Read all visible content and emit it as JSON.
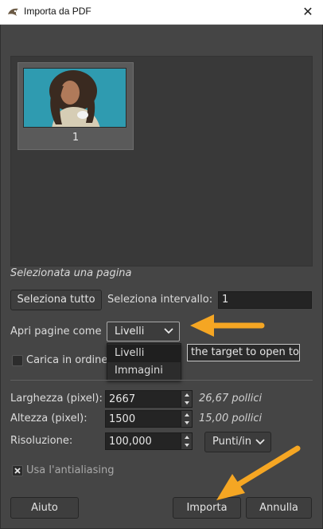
{
  "window": {
    "title": "Importa da PDF",
    "close_glyph": "✕",
    "app_icon": "gimp-icon"
  },
  "preview": {
    "pages": [
      {
        "number": "1"
      }
    ]
  },
  "status_text": "Selezionata una pagina",
  "selection": {
    "select_all_label": "Seleziona tutto",
    "range_label": "Seleziona intervallo:",
    "range_value": "1"
  },
  "open_pages": {
    "label": "Apri pagine come",
    "selected": "Livelli",
    "options": [
      "Livelli",
      "Immagini"
    ]
  },
  "load_in_order": {
    "label": "Carica in ordine",
    "checked": false
  },
  "target_field": {
    "value": "the target to open to"
  },
  "dimensions": {
    "width_label": "Larghezza (pixel):",
    "width_value": "2667",
    "width_inches": "26,67 pollici",
    "height_label": "Altezza (pixel):",
    "height_value": "1500",
    "height_inches": "15,00 pollici",
    "resolution_label": "Risoluzione:",
    "resolution_value": "100,000",
    "resolution_unit": "Punti/in"
  },
  "antialiasing": {
    "label": "Usa l'antialiasing",
    "checked": true
  },
  "buttons": {
    "help": "Aiuto",
    "import": "Importa",
    "cancel": "Annulla"
  },
  "colors": {
    "annotation_arrow": "#f5a623",
    "preview_bg": "#2f9bb0"
  }
}
